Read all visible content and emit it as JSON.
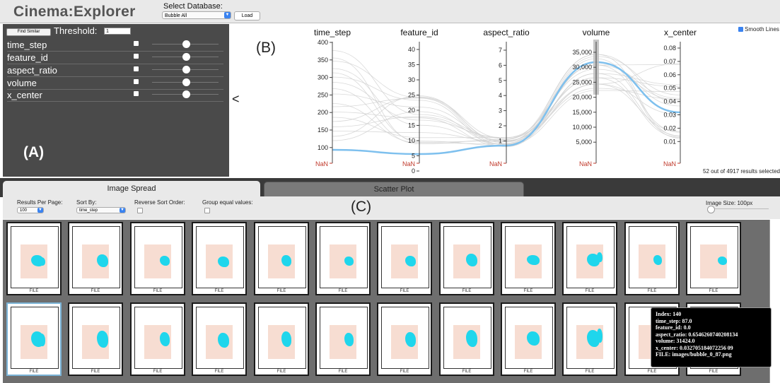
{
  "app": {
    "title": "Cinema:Explorer",
    "db_label": "Select Database:",
    "db_value": "Bubble All",
    "load_label": "Load"
  },
  "query": {
    "find_similar_label": "Find Similar",
    "threshold_label": "Threshold:",
    "threshold_value": "1",
    "params": [
      {
        "name": "time_step",
        "checked": true,
        "level": 0.5
      },
      {
        "name": "feature_id",
        "checked": true,
        "level": 0.5
      },
      {
        "name": "aspect_ratio",
        "checked": true,
        "level": 0.5
      },
      {
        "name": "volume",
        "checked": true,
        "level": 0.5
      },
      {
        "name": "x_center",
        "checked": true,
        "level": 0.5
      }
    ],
    "panel_label": "(A)",
    "collapse_glyph": "<"
  },
  "pcoord": {
    "panel_label": "(B)",
    "smooth_lines_label": "Smooth Lines",
    "smooth_lines_checked": true,
    "results_text": "52 out of 4917 results selected",
    "nan_label": "NaN",
    "axes": [
      {
        "name": "time_step",
        "ticks": [
          "400",
          "350",
          "300",
          "250",
          "200",
          "150",
          "100"
        ]
      },
      {
        "name": "feature_id",
        "ticks": [
          "40",
          "35",
          "30",
          "25",
          "20",
          "15",
          "10",
          "5",
          "0"
        ]
      },
      {
        "name": "aspect_ratio",
        "ticks": [
          "7",
          "6",
          "5",
          "4",
          "3",
          "2",
          "1"
        ]
      },
      {
        "name": "volume",
        "ticks": [
          "35,000",
          "30,000",
          "25,000",
          "20,000",
          "15,000",
          "10,000",
          "5,000"
        ]
      },
      {
        "name": "x_center",
        "ticks": [
          "0.08",
          "0.07",
          "0.06",
          "0.05",
          "0.04",
          "0.03",
          "0.02",
          "0.01"
        ]
      }
    ],
    "highlight_color": "#7ec0ee",
    "line_color": "#cfcfcf"
  },
  "view": {
    "tabs": [
      "Image Spread",
      "Scatter Plot"
    ],
    "panel_label": "(C)",
    "results_per_page_label": "Results Per Page:",
    "results_per_page_value": "100",
    "sort_by_label": "Sort By:",
    "sort_by_value": "time_step",
    "reverse_label": "Reverse Sort Order:",
    "group_label": "Group equal values:",
    "image_size_label": "Image Size: 100px"
  },
  "thumbnails": {
    "file_label": "FILE",
    "blob_color": "#1fd6ec",
    "background_color": "#f7ddd2"
  },
  "tooltip": {
    "lines": [
      "Index: 140",
      "time_step: 87.0",
      "feature_id: 0.0",
      "aspect_ratio: 0.6546260740208134",
      "volume: 31424.0",
      "x_center: 0.032705184072256 09",
      "FILE: images/bubble_0_87.png"
    ]
  }
}
